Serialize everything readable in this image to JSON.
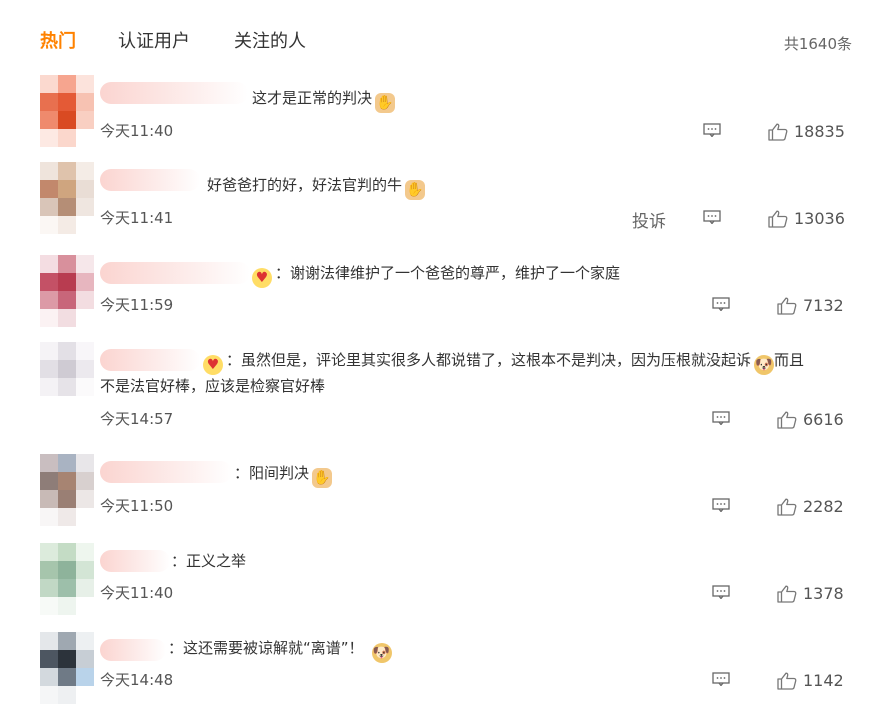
{
  "tabs": {
    "hot": "热门",
    "verified": "认证用户",
    "following": "关注的人"
  },
  "total_count": "共1640条",
  "report_label": "投诉",
  "comments": [
    {
      "text": "这才是正常的判决",
      "emoji": "👍",
      "time": "今天11:40",
      "likes": "18835"
    },
    {
      "text": "好爸爸打的好，好法官判的牛",
      "emoji": "👍",
      "time": "今天11:41",
      "likes": "13036"
    },
    {
      "text": "谢谢法律维护了一个爸爸的尊严，维护了一个家庭",
      "time": "今天11:59",
      "likes": "7132"
    },
    {
      "text_line1": "虽然但是，评论里其实很多人都说错了，这根本不是判决，因为压根就没起诉",
      "text_line1_tail": "而且",
      "text_line2": "不是法官好棒，应该是检察官好棒",
      "time": "今天14:57",
      "likes": "6616"
    },
    {
      "text": "阳间判决",
      "emoji": "👍",
      "time": "今天11:50",
      "likes": "2282"
    },
    {
      "text": "正义之举",
      "time": "今天11:40",
      "likes": "1378"
    },
    {
      "text": "这还需要被谅解就“离谱”！",
      "emoji": "🐶",
      "time": "今天14:48",
      "likes": "1142"
    }
  ],
  "colors": {
    "accent": "#ff8200",
    "text": "#333333",
    "meta": "#555555"
  }
}
